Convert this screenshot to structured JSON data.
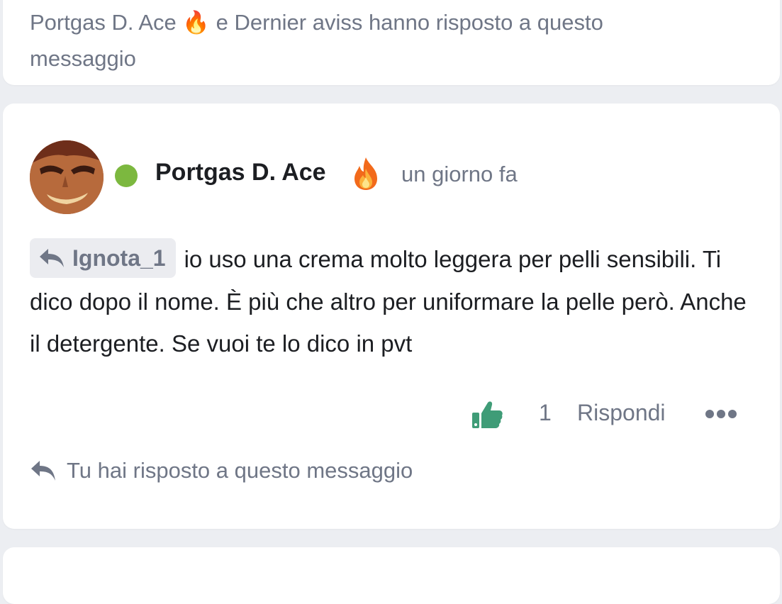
{
  "previous_post": {
    "replied_line": "Portgas D. Ace 🔥 e Dernier aviss hanno risposto a questo",
    "replied_line_end": "messaggio"
  },
  "post": {
    "author": "Portgas D. Ace",
    "author_emoji": "fire",
    "online_status": "online",
    "timestamp": "un giorno fa",
    "reply_to": "Ignota_1",
    "message": "io uso una crema molto leggera per pelli sensibili. Ti dico dopo il nome. È più che altro per uniformare la pelle però. Anche il detergente. Se vuoi te lo dico in pvt",
    "like_count": "1",
    "reply_label": "Rispondi",
    "replied_note": "Tu hai risposto a questo messaggio"
  },
  "colors": {
    "online": "#7cb83f",
    "like": "#3f9c77",
    "muted": "#6f7686",
    "text": "#1c1e22",
    "card_bg": "#ffffff",
    "page_bg": "#eceef2"
  },
  "icons": {
    "reply": "reply-arrow-icon",
    "like": "thumbs-up-icon",
    "more": "more-dots-icon",
    "emoji": "fire-icon"
  }
}
